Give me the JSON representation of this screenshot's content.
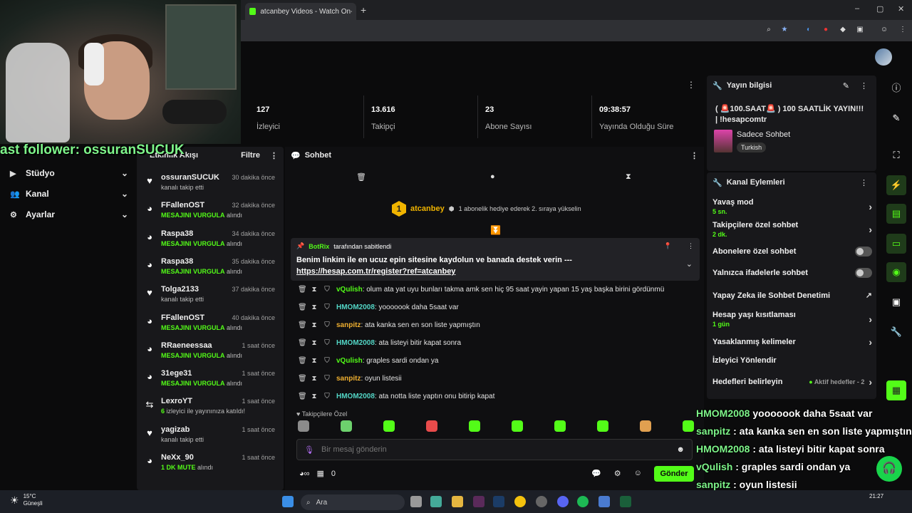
{
  "browser": {
    "tab_title": "atcanbey Videos - Watch On-D",
    "new_tab": "+",
    "minimize": "–",
    "maximize": "▢",
    "close": "✕"
  },
  "overlay": {
    "follower_text": "ast follower: ossuranSUCUK",
    "chat_lines": [
      {
        "user": "HMOM2008",
        "text": "yooooook daha 5saat var"
      },
      {
        "user": "sanpitz",
        "text": ": ata kanka sen en son liste yapmıştın"
      },
      {
        "user": "HMOM2008",
        "text": ": ata listeyi bitir kapat sonra"
      },
      {
        "user": "vQulish",
        "text": ": graples sardi ondan ya"
      },
      {
        "user": "sanpitz",
        "text": ": oyun listesii"
      },
      {
        "user": "HMOM2008",
        "text": ": ata notta liste yaptın onu bitirip"
      }
    ]
  },
  "leftnav": {
    "items": [
      {
        "label": "Stüdyo",
        "icon": "▶"
      },
      {
        "label": "Kanal",
        "icon": "👥"
      },
      {
        "label": "Ayarlar",
        "icon": "⚙"
      }
    ]
  },
  "feed": {
    "title": "Etkinlik Akışı",
    "filter": "Filtre",
    "items": [
      {
        "name": "ossuranSUCUK",
        "time": "30 dakika önce",
        "desc": "kanalı takip etti",
        "hl": "",
        "suffix": "",
        "icon": "♥"
      },
      {
        "name": "FFallenOST",
        "time": "32 dakika önce",
        "desc": "",
        "hl": "MESAJINI VURGULA",
        "suffix": " alındı",
        "icon": "◕"
      },
      {
        "name": "Raspa38",
        "time": "34 dakika önce",
        "desc": "",
        "hl": "MESAJINI VURGULA",
        "suffix": " alındı",
        "icon": "◕"
      },
      {
        "name": "Raspa38",
        "time": "35 dakika önce",
        "desc": "",
        "hl": "MESAJINI VURGULA",
        "suffix": " alındı",
        "icon": "◕"
      },
      {
        "name": "Tolga2133",
        "time": "37 dakika önce",
        "desc": "kanalı takip etti",
        "hl": "",
        "suffix": "",
        "icon": "♥"
      },
      {
        "name": "FFallenOST",
        "time": "40 dakika önce",
        "desc": "",
        "hl": "MESAJINI VURGULA",
        "suffix": " alındı",
        "icon": "◕"
      },
      {
        "name": "RRaeneessaa",
        "time": "1 saat önce",
        "desc": "",
        "hl": "MESAJINI VURGULA",
        "suffix": " alındı",
        "icon": "◕"
      },
      {
        "name": "31ege31",
        "time": "1 saat önce",
        "desc": "",
        "hl": "MESAJINI VURGULA",
        "suffix": " alındı",
        "icon": "◕"
      },
      {
        "name": "LexroYT",
        "time": "1 saat önce",
        "desc": "",
        "hl": "6",
        "suffix": " izleyici ile yayınınıza katıldı!",
        "icon": "⇆"
      },
      {
        "name": "yagizab",
        "time": "1 saat önce",
        "desc": "kanalı takip etti",
        "hl": "",
        "suffix": "",
        "icon": "♥"
      },
      {
        "name": "NeXx_90",
        "time": "1 saat önce",
        "desc": "",
        "hl": "1 DK MUTE",
        "suffix": " alındı",
        "icon": "◕"
      }
    ]
  },
  "stats": [
    {
      "value": "127",
      "label": "İzleyici"
    },
    {
      "value": "13.616",
      "label": "Takipçi"
    },
    {
      "value": "23",
      "label": "Abone Sayısı"
    },
    {
      "value": "09:38:57",
      "label": "Yayında Olduğu Süre"
    }
  ],
  "chat": {
    "title": "Sohbet",
    "goal_user": "atcanbey",
    "goal_level": "1",
    "goal_text": "1 abonelik hediye ederek 2. sıraya yükselin",
    "pinned_by": "BotRix",
    "pinned_suffix": "tarafından sabitlendi",
    "pinned_text": "Benim linkim ile en ucuz epin sitesine kaydolun ve banada destek verin --- ",
    "pinned_link": "https://hesap.com.tr/register?ref=atcanbey",
    "messages": [
      {
        "user": "vQulish",
        "color": "#53fc18",
        "text": ": olum ata yat uyu bunları takma amk sen hiç 95 saat yayin yapan 15 yaş başka birini gördünmü"
      },
      {
        "user": "HMOM2008",
        "color": "#53d6c6",
        "text": ": yooooook daha 5saat var"
      },
      {
        "user": "sanpitz",
        "color": "#f0b030",
        "text": ": ata kanka sen en son liste yapmıştın"
      },
      {
        "user": "HMOM2008",
        "color": "#53d6c6",
        "text": ": ata listeyi bitir kapat sonra"
      },
      {
        "user": "vQulish",
        "color": "#53fc18",
        "text": ": graples sardi ondan ya"
      },
      {
        "user": "sanpitz",
        "color": "#f0b030",
        "text": ": oyun listesii"
      },
      {
        "user": "HMOM2008",
        "color": "#53d6c6",
        "text": ": ata notta liste yaptın onu bitirip kapat"
      }
    ],
    "followers_only": "Takipçilere Özel",
    "input_placeholder": "Bir mesaj gönderin",
    "points": "0",
    "send": "Gönder"
  },
  "info": {
    "title": "Yayın bilgisi",
    "stream_title": "( 🚨100.SAAT🚨 ) 100 SAATLİK YAYIN!!! | !hesapcomtr",
    "category": "Sadece Sohbet",
    "tag": "Turkish"
  },
  "actions": {
    "title": "Kanal Eylemleri",
    "items": [
      {
        "label": "Yavaş mod",
        "sub": "5 sn.",
        "type": "chevron"
      },
      {
        "label": "Takipçilere özel sohbet",
        "sub": "2 dk.",
        "type": "chevron"
      },
      {
        "label": "Abonelere özel sohbet",
        "sub": "",
        "type": "toggle"
      },
      {
        "label": "Yalnızca ifadelerle sohbet",
        "sub": "",
        "type": "toggle"
      },
      {
        "label": "Yapay Zeka ile Sohbet Denetimi",
        "sub": "",
        "type": "external"
      },
      {
        "label": "Hesap yaşı kısıtlaması",
        "sub": "1 gün",
        "type": "chevron"
      },
      {
        "label": "Yasaklanmış kelimeler",
        "sub": "",
        "type": "chevron"
      },
      {
        "label": "İzleyici Yönlendir",
        "sub": "",
        "type": "none"
      },
      {
        "label": "Hedefleri belirleyin",
        "sub": "",
        "type": "goals"
      }
    ],
    "goals_text": "Aktif hedefler - 2"
  },
  "taskbar": {
    "temp": "15°C",
    "weather": "Güneşli",
    "search": "Ara",
    "time": "21:27"
  }
}
